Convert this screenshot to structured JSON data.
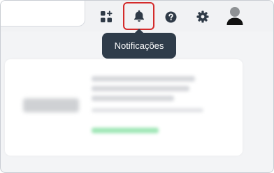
{
  "header": {
    "icons": {
      "apps": "apps-add-icon",
      "notifications": "bell-icon",
      "help": "question-circle-icon",
      "settings": "gear-icon",
      "profile": "user-avatar-icon"
    }
  },
  "tooltip": {
    "text": "Notificações"
  },
  "colors": {
    "icon": "#2f3a47",
    "highlight_border": "#d42b2b",
    "tooltip_bg": "#2f3c4a",
    "page_bg": "#f3f4f6"
  }
}
